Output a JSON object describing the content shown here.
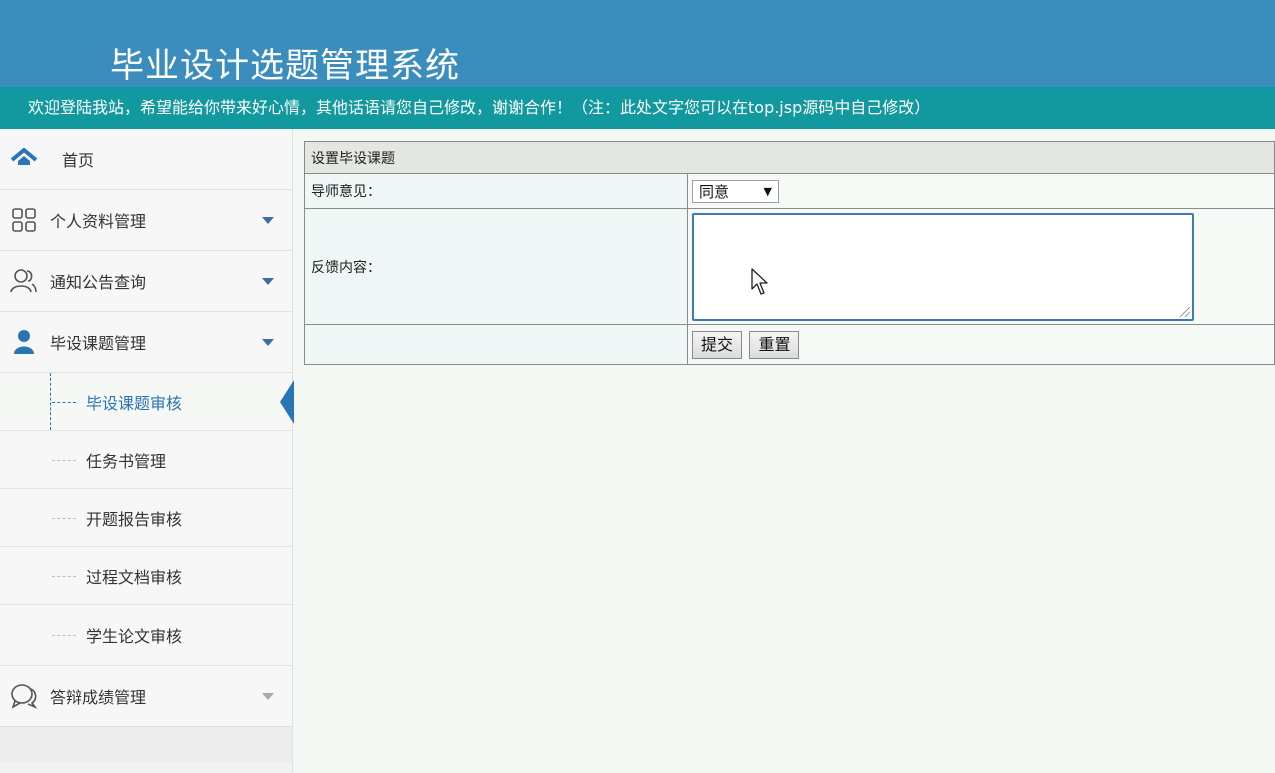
{
  "header": {
    "title": "毕业设计选题管理系统",
    "welcome": "欢迎登陆我站，希望能给你带来好心情，其他话语请您自己修改，谢谢合作！（注：此处文字您可以在top.jsp源码中自己修改）"
  },
  "sidebar": {
    "items": [
      {
        "label": "首页",
        "icon": "home-icon"
      },
      {
        "label": "个人资料管理",
        "icon": "grid-icon"
      },
      {
        "label": "通知公告查询",
        "icon": "users-icon"
      },
      {
        "label": "毕设课题管理",
        "icon": "user-icon"
      }
    ],
    "subitems": [
      {
        "label": "毕设课题审核",
        "active": true
      },
      {
        "label": "任务书管理"
      },
      {
        "label": "开题报告审核"
      },
      {
        "label": "过程文档审核"
      },
      {
        "label": "学生论文审核"
      }
    ],
    "last_item": {
      "label": "答辩成绩管理",
      "icon": "chat-icon"
    }
  },
  "form": {
    "caption": "设置毕设课题",
    "opinion_label": "导师意见：",
    "opinion_value": "同意",
    "feedback_label": "反馈内容：",
    "feedback_value": "",
    "submit_label": "提交",
    "reset_label": "重置"
  },
  "colors": {
    "header_bg": "#3a8dbd",
    "welcome_bg": "#11999f",
    "accent": "#2a75b3"
  }
}
